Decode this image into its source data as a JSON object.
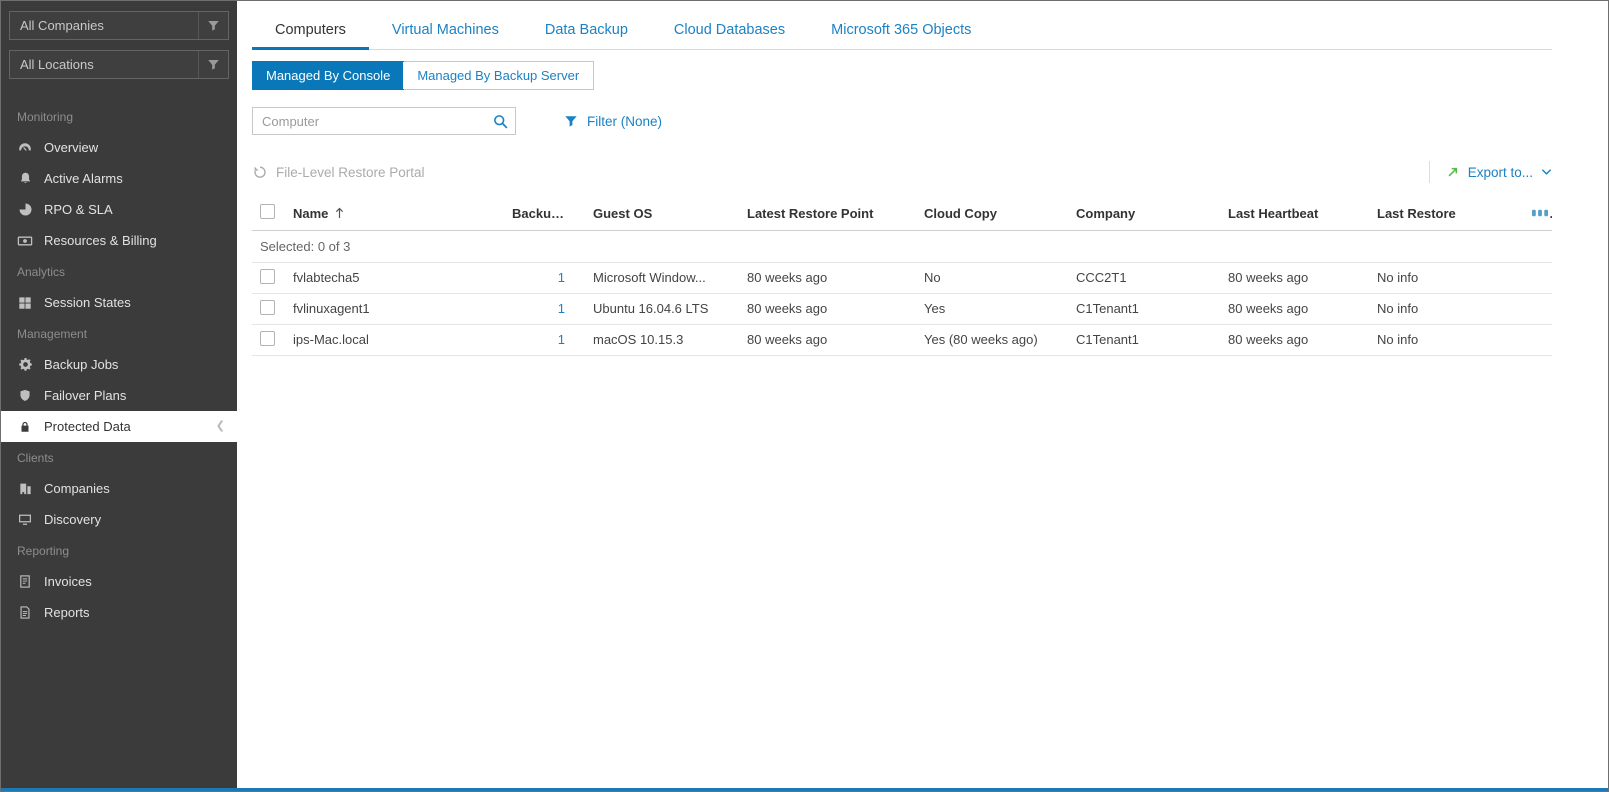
{
  "window": {
    "accent_blue": "#0a78b8",
    "link_blue": "#1b82c4",
    "export_green": "#54b948",
    "sidebar_bg": "#3b3b3b",
    "bottom_bar_blue": "#1a7ab5"
  },
  "sidebar": {
    "companies_filter": "All Companies",
    "locations_filter": "All Locations",
    "filter_icon": "funnel-icon",
    "groups": [
      {
        "label": "Monitoring",
        "items": [
          {
            "label": "Overview",
            "icon": "gauge-icon"
          },
          {
            "label": "Active Alarms",
            "icon": "bell-icon"
          },
          {
            "label": "RPO & SLA",
            "icon": "pie-clock-icon"
          },
          {
            "label": "Resources & Billing",
            "icon": "billing-icon"
          }
        ]
      },
      {
        "label": "Analytics",
        "items": [
          {
            "label": "Session States",
            "icon": "grid-icon"
          }
        ]
      },
      {
        "label": "Management",
        "items": [
          {
            "label": "Backup Jobs",
            "icon": "gear-icon"
          },
          {
            "label": "Failover Plans",
            "icon": "shield-icon"
          },
          {
            "label": "Protected Data",
            "icon": "lock-icon",
            "selected": true
          }
        ]
      },
      {
        "label": "Clients",
        "items": [
          {
            "label": "Companies",
            "icon": "building-icon"
          },
          {
            "label": "Discovery",
            "icon": "monitor-icon"
          }
        ]
      },
      {
        "label": "Reporting",
        "items": [
          {
            "label": "Invoices",
            "icon": "invoice-icon"
          },
          {
            "label": "Reports",
            "icon": "report-icon"
          }
        ]
      }
    ]
  },
  "tabs": [
    {
      "label": "Computers",
      "active": true
    },
    {
      "label": "Virtual Machines",
      "active": false
    },
    {
      "label": "Data Backup",
      "active": false
    },
    {
      "label": "Cloud Databases",
      "active": false
    },
    {
      "label": "Microsoft 365 Objects",
      "active": false
    }
  ],
  "view_toggle": {
    "console_label": "Managed By Console",
    "backup_server_label": "Managed By Backup Server"
  },
  "toolbar": {
    "search_placeholder": "Computer",
    "search_icon": "search-icon",
    "filter_label": "Filter (None)",
    "filter_icon": "funnel-icon",
    "flr_label": "File-Level Restore Portal",
    "flr_icon": "restore-icon",
    "export_label": "Export to...",
    "export_icon": "arrow-up-right-icon",
    "export_caret_icon": "chevron-down-icon"
  },
  "table": {
    "headers": {
      "name": "Name",
      "backups": "Backups",
      "guest_os": "Guest OS",
      "latest_restore_point": "Latest Restore Point",
      "cloud_copy": "Cloud Copy",
      "company": "Company",
      "last_heartbeat": "Last Heartbeat",
      "last_restore": "Last Restore"
    },
    "sort": {
      "column": "Name",
      "direction": "ascending",
      "icon": "sort-ascending-icon"
    },
    "columns_chooser_icon": "columns-icon",
    "selected_summary": "Selected: 0 of 3",
    "rows": [
      {
        "name": "fvlabtecha5",
        "backups": "1",
        "guest_os": "Microsoft Window...",
        "latest_restore_point": "80 weeks ago",
        "cloud_copy": "No",
        "company": "CCC2T1",
        "last_heartbeat": "80 weeks ago",
        "last_restore": "No info"
      },
      {
        "name": "fvlinuxagent1",
        "backups": "1",
        "guest_os": "Ubuntu 16.04.6 LTS",
        "latest_restore_point": "80 weeks ago",
        "cloud_copy": "Yes",
        "company": "C1Tenant1",
        "last_heartbeat": "80 weeks ago",
        "last_restore": "No info"
      },
      {
        "name": "ips-Mac.local",
        "backups": "1",
        "guest_os": "macOS 10.15.3",
        "latest_restore_point": "80 weeks ago",
        "cloud_copy": "Yes (80 weeks ago)",
        "company": "C1Tenant1",
        "last_heartbeat": "80 weeks ago",
        "last_restore": "No info"
      }
    ]
  }
}
